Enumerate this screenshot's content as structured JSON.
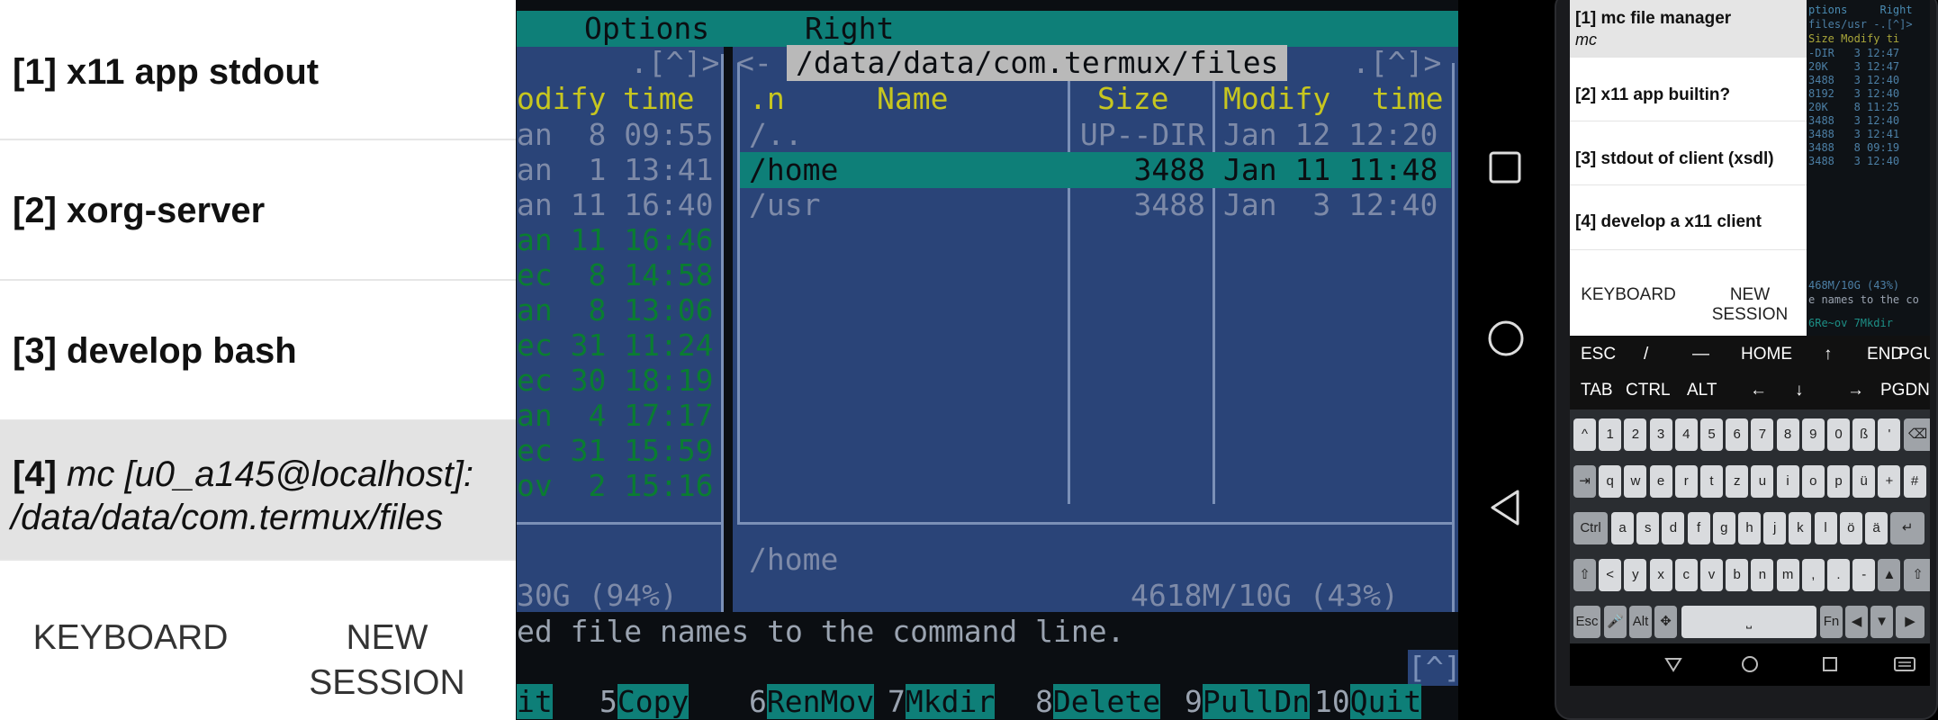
{
  "drawer": {
    "sessions": [
      {
        "num": "[1]",
        "label": "x11 app stdout"
      },
      {
        "num": "[2]",
        "label": "xorg-server"
      },
      {
        "num": "[3]",
        "label": "develop bash"
      },
      {
        "num": "[4]",
        "label_line1": "mc [u0_a145@localhost]:",
        "label_line2": "/data/data/com.termux/files"
      }
    ],
    "keyboard_label": "KEYBOARD",
    "new_session_line1": "NEW",
    "new_session_line2": "SESSION"
  },
  "terminal": {
    "menu_options": "Options",
    "menu_right": "Right",
    "left_panel_header": ".[^]>",
    "left_panel_col_modify": "odify",
    "left_panel_col_time": "time",
    "left_rows": [
      "an  8 09:55",
      "an  1 13:41",
      "an 11 16:40",
      "an 11 16:46",
      "ec  8 14:58",
      "an  8 13:06",
      "ec 31 11:24",
      "ec 30 18:19",
      "an  4 17:17",
      "ec 31 15:59",
      "ov  2 15:16"
    ],
    "left_footer": "30G (94%)",
    "right_panel_path": "/data/data/com.termux/files",
    "right_panel_prefix": "<-",
    "right_panel_suffix": ".[^]>",
    "col_n": ".n",
    "col_name": "Name",
    "col_size": "Size",
    "col_modify": "Modify",
    "col_time": "time",
    "files": [
      {
        "name": "/..",
        "size": "UP--DIR",
        "date": "Jan 12 12:20"
      },
      {
        "name": "/home",
        "size": "3488",
        "date": "Jan 11 11:48"
      },
      {
        "name": "/usr",
        "size": "3488",
        "date": "Jan  3 12:40"
      }
    ],
    "selected_path": "/home",
    "disk_usage": "4618M/10G (43%)",
    "hint_text": "ed file names to the command line.",
    "caret_label": "[^]",
    "fkeys": [
      {
        "num": "",
        "label": "it"
      },
      {
        "num": "5",
        "label": "Copy"
      },
      {
        "num": "6",
        "label": "RenMov"
      },
      {
        "num": "7",
        "label": "Mkdir"
      },
      {
        "num": "8",
        "label": "Delete"
      },
      {
        "num": "9",
        "label": "PullDn"
      },
      {
        "num": "10",
        "label": "Quit"
      }
    ]
  },
  "phone": {
    "sessions": [
      {
        "label": "[1] mc file manager",
        "sub": "mc"
      },
      {
        "label": "[2] x11 app builtin?"
      },
      {
        "label": "[3] stdout of client (xsdl)"
      },
      {
        "label": "[4] develop a x11 client"
      }
    ],
    "keyboard_label": "KEYBOARD",
    "new_session_line1": "NEW",
    "new_session_line2": "SESSION",
    "extra_keys_row1": [
      "ESC",
      "/",
      "—",
      "HOME",
      "↑",
      "END",
      "PGUP"
    ],
    "extra_keys_row2": [
      "TAB",
      "CTRL",
      "ALT",
      "←",
      "↓",
      "→",
      "PGDN"
    ],
    "kb_row1": [
      "^",
      "1",
      "2",
      "3",
      "4",
      "5",
      "6",
      "7",
      "8",
      "9",
      "0",
      "ß",
      "'"
    ],
    "kb_row2": [
      "q",
      "w",
      "e",
      "r",
      "t",
      "z",
      "u",
      "i",
      "o",
      "p",
      "ü",
      "+",
      "#"
    ],
    "kb_row3": [
      "a",
      "s",
      "d",
      "f",
      "g",
      "h",
      "j",
      "k",
      "l",
      "ö",
      "ä"
    ],
    "kb_row4": [
      "<",
      "y",
      "x",
      "c",
      "v",
      "b",
      "n",
      "m",
      ",",
      ".",
      "-"
    ],
    "kb_ctrl": "Ctrl",
    "kb_esc": "Esc",
    "kb_alt": "Alt",
    "kb_fn": "Fn",
    "mini_terminal": {
      "menu": "ptions     Right",
      "path": "files/usr -.[^]>",
      "cols": "Size Modify ti",
      "rows": [
        "-DIR   3 12:47",
        "20K    3 12:47",
        "3488   3 12:40",
        "8192   3 12:40",
        "20K    8 11:25",
        "3488   3 12:40",
        "3488   3 12:41",
        "3488   8 09:19",
        "3488   3 12:40"
      ],
      "usage": "468M/10G (43%)",
      "hint": "e names to the co",
      "fkeys": "6Re~ov 7Mkdir"
    }
  }
}
